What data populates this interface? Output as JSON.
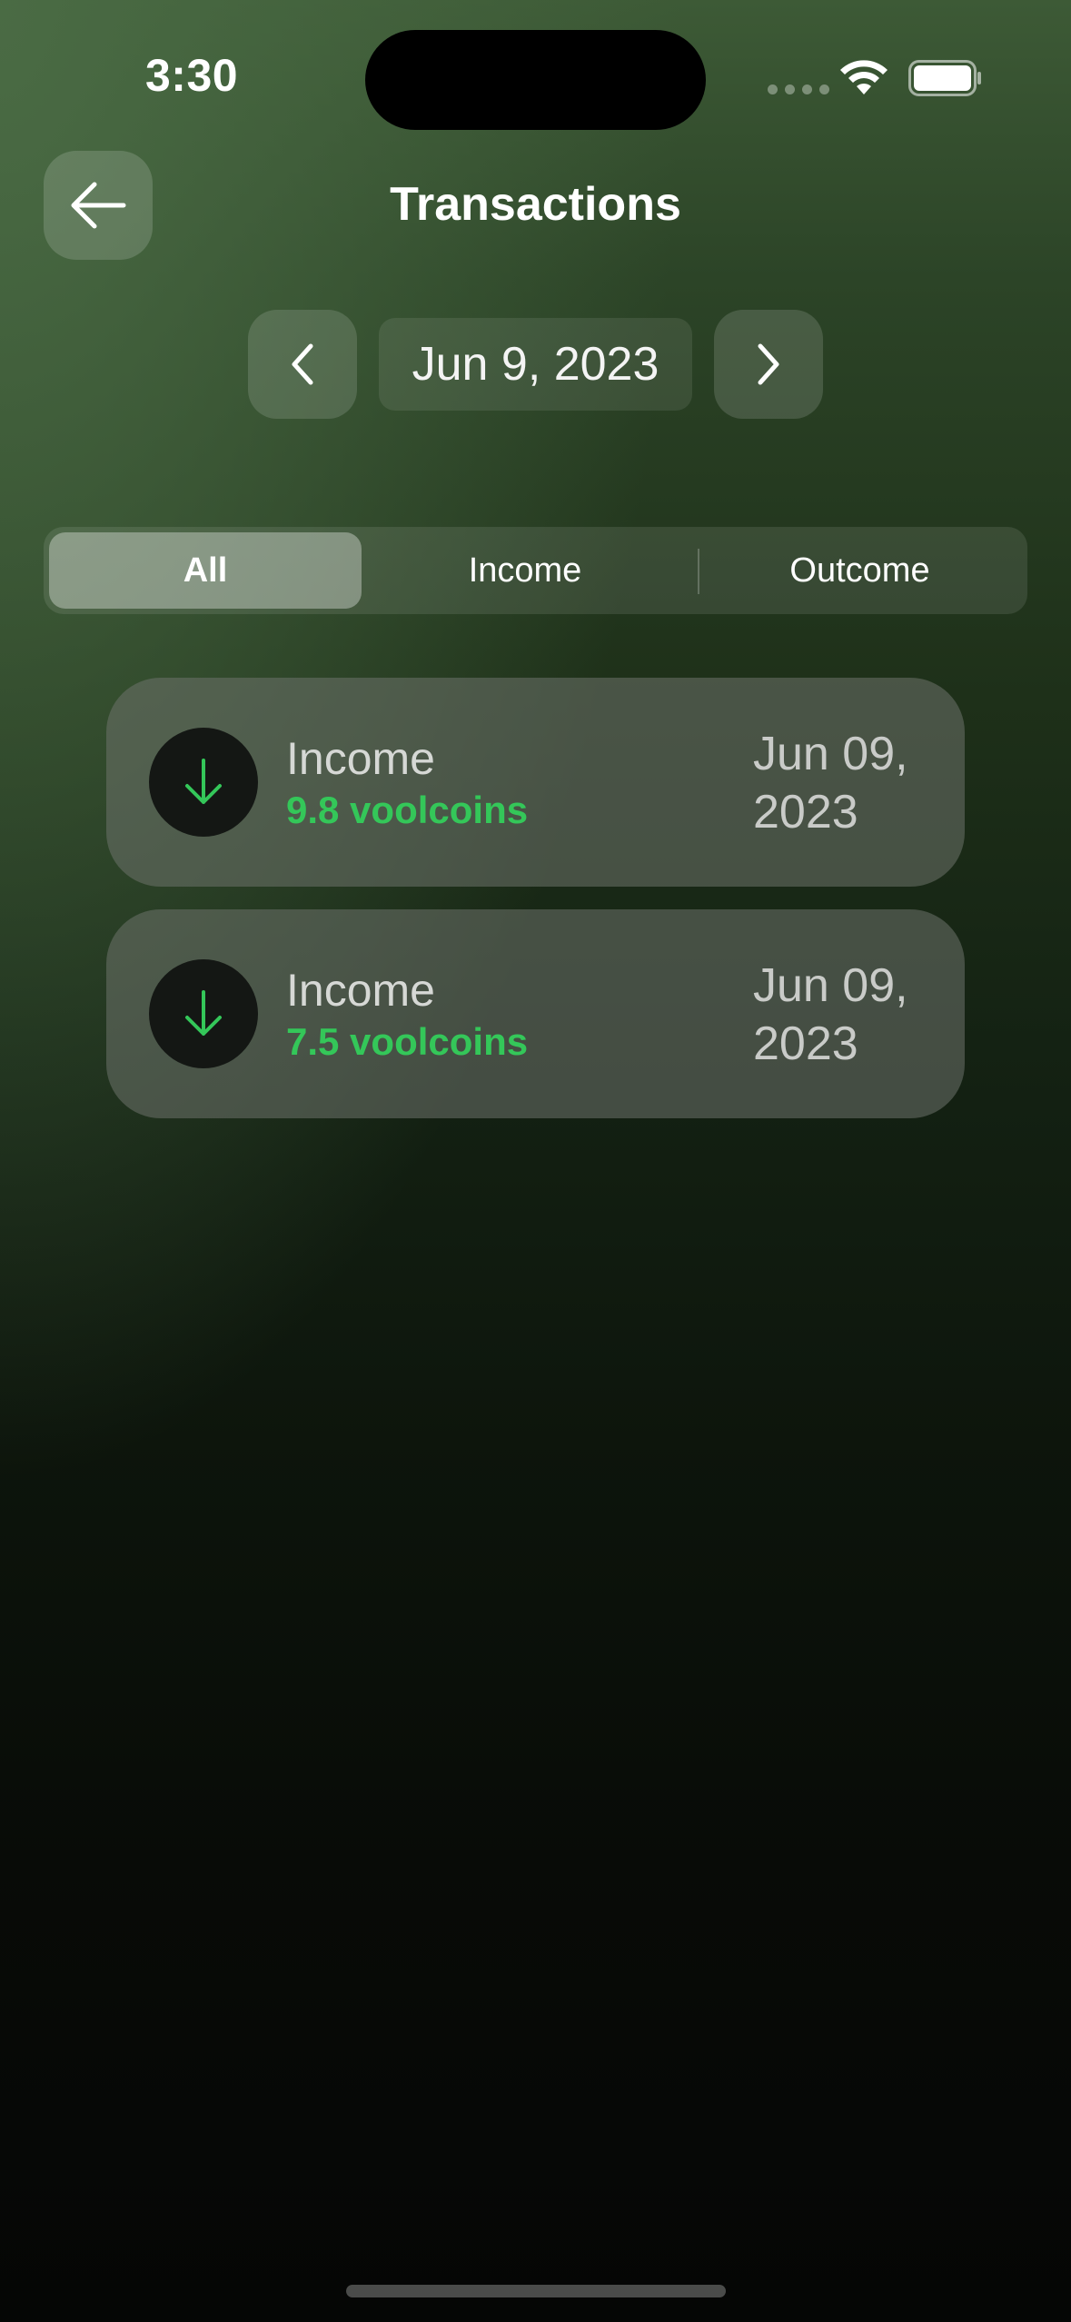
{
  "status_bar": {
    "time": "3:30",
    "wifi_icon": "wifi-icon",
    "battery_icon": "battery-icon"
  },
  "header": {
    "title": "Transactions",
    "back_icon": "arrow-left-icon"
  },
  "date_nav": {
    "current_date": "Jun 9, 2023",
    "prev_icon": "chevron-left-icon",
    "next_icon": "chevron-right-icon"
  },
  "filter": {
    "options": [
      "All",
      "Income",
      "Outcome"
    ],
    "selected": "All"
  },
  "transactions": [
    {
      "type": "Income",
      "amount": "9.8 voolcoins",
      "date_line1": "Jun 09,",
      "date_line2": "2023",
      "icon": "arrow-down-icon"
    },
    {
      "type": "Income",
      "amount": "7.5 voolcoins",
      "date_line1": "Jun 09,",
      "date_line2": "2023",
      "icon": "arrow-down-icon"
    }
  ],
  "colors": {
    "income_green": "#34c759",
    "background_top": "#3d5a36",
    "background_bottom": "#050605"
  }
}
